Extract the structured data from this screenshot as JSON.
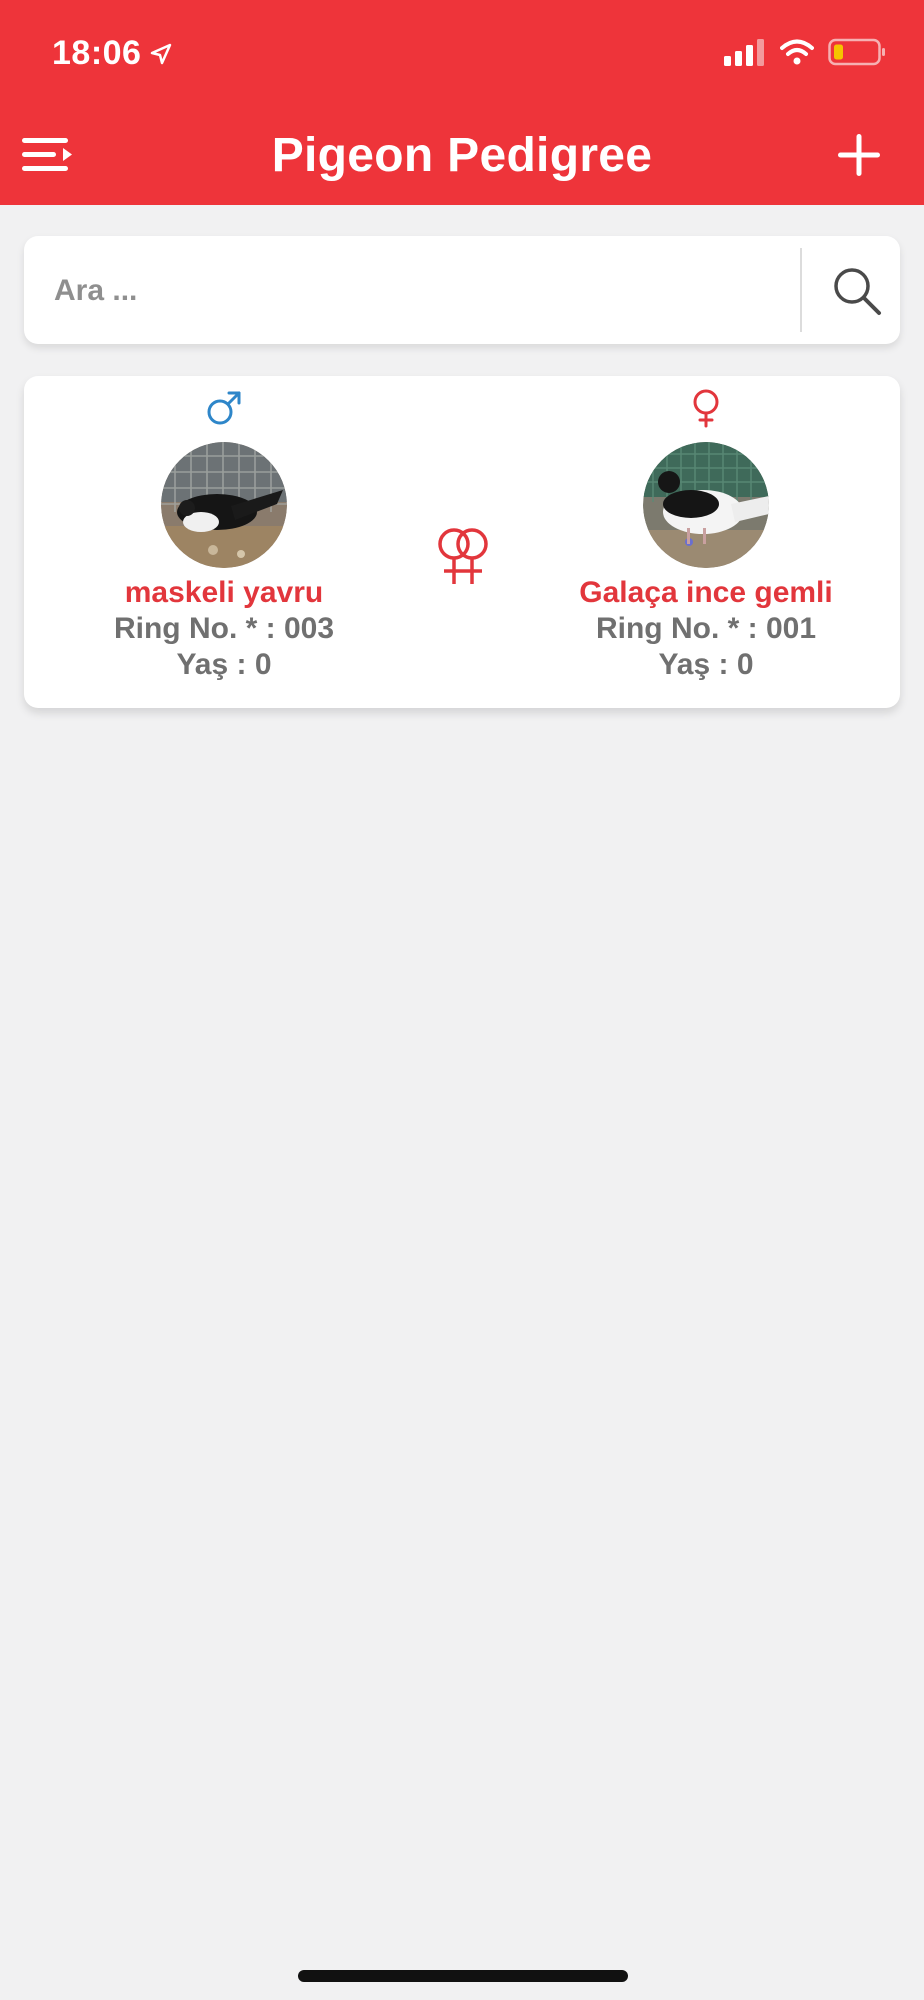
{
  "status_bar": {
    "time": "18:06"
  },
  "header": {
    "title": "Pigeon Pedigree"
  },
  "search": {
    "placeholder": "Ara ..."
  },
  "pair": {
    "male": {
      "name": "maskeli yavru",
      "ring": "Ring No. * : 003",
      "age": "Yaş : 0"
    },
    "female": {
      "name": "Galaça ince gemli",
      "ring": "Ring No. * : 001",
      "age": "Yaş : 0"
    }
  },
  "colors": {
    "accent": "#ee343a",
    "male": "#2e86c9",
    "female": "#e2363c"
  },
  "icons": [
    "menu-icon",
    "add-icon",
    "search-icon",
    "male-icon",
    "female-icon",
    "pair-icon"
  ]
}
